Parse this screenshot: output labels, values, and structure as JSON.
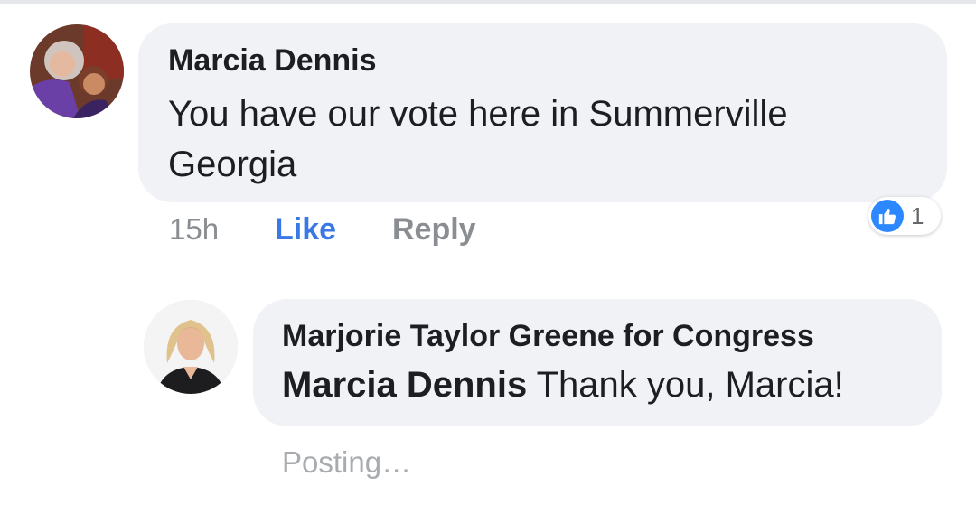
{
  "comments": [
    {
      "author": "Marcia Dennis",
      "text": "You have our vote here in Summerville Georgia",
      "time": "15h",
      "like_label": "Like",
      "reply_label": "Reply",
      "reaction_count": "1",
      "reaction_icon": "thumbs-up-icon"
    }
  ],
  "reply": {
    "author": "Marjorie Taylor Greene for Congress",
    "mention": "Marcia Dennis",
    "text": " Thank you, Marcia!",
    "status": "Posting…"
  },
  "colors": {
    "bubble": "#f0f2f5",
    "like_blue": "#3b78e7",
    "reaction_blue": "#2d88ff",
    "meta_gray": "#8a8d91"
  }
}
